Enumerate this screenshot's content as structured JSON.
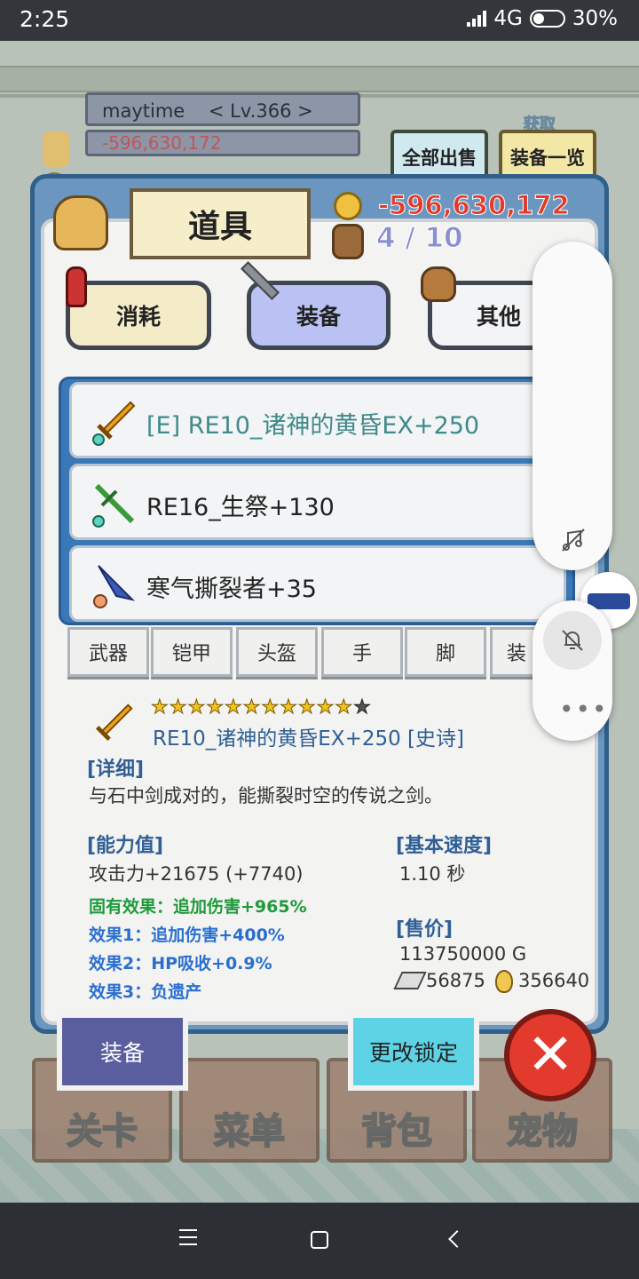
{
  "status_bar": {
    "time": "2:25",
    "network": "4G",
    "battery": "30%"
  },
  "player": {
    "name": "maytime",
    "level": "< Lv.366 >",
    "gold_small": "-596,630,172"
  },
  "top_buttons": {
    "sell_all": "全部出售",
    "equip_list": "装备一览",
    "faded_label": "获取"
  },
  "panel": {
    "title": "道具",
    "gold": "-596,630,172",
    "capacity": "4 / 10",
    "category_tabs": [
      {
        "label": "消耗",
        "icon": "potion-icon"
      },
      {
        "label": "装备",
        "icon": "sword-icon"
      },
      {
        "label": "其他",
        "icon": "bag-icon"
      }
    ],
    "items": [
      {
        "name": "[E] RE10_诸神的黄昏EX+250",
        "icon": "golden-sword-icon",
        "color": "#3f8a8a"
      },
      {
        "name": "RE16_生祭+130",
        "icon": "green-staff-icon",
        "color": "#222222"
      },
      {
        "name": "寒气撕裂者+35",
        "icon": "ice-blade-icon",
        "color": "#222222"
      }
    ],
    "slot_tabs": [
      "武器",
      "铠甲",
      "头盔",
      "手",
      "脚",
      "装"
    ]
  },
  "detail": {
    "stars_filled": 11,
    "stars_total": 12,
    "name": "RE10_诸神的黄昏EX+250 [史诗]",
    "detail_header": "[详细]",
    "description": "与石中剑成对的，能撕裂时空的传说之剑。",
    "stats_header": "[能力值]",
    "attack": "攻击力+21675 (+7740)",
    "inherent": "固有效果：追加伤害+965%",
    "effects": [
      "效果1：追加伤害+400%",
      "效果2：HP吸收+0.9%",
      "效果3：负遗产"
    ],
    "speed_header": "[基本速度]",
    "speed": "1.10 秒",
    "price_header": "[售价]",
    "price": "113750000 G",
    "crystal": "56875",
    "drop": "356640"
  },
  "actions": {
    "equip": "装备",
    "toggle_lock": "更改锁定"
  },
  "bottom_nav": [
    "关卡",
    "菜单",
    "背包",
    "宠物"
  ],
  "colors": {
    "panel_blue": "#6a96c0",
    "selected_tab": "#b9c2f2",
    "lock_btn": "#5fd3e6",
    "close_red": "#e23a2c"
  }
}
